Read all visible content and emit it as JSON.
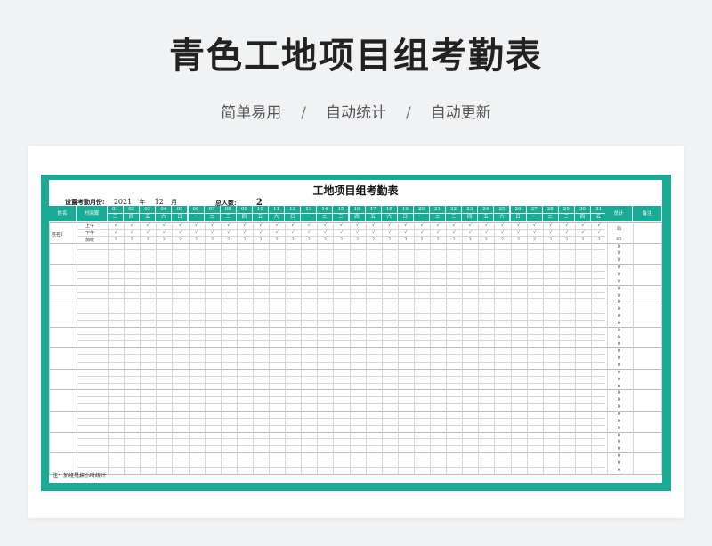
{
  "hero": {
    "title": "青色工地项目组考勤表",
    "subtitles": [
      "简单易用",
      "自动统计",
      "自动更新"
    ],
    "separator": "/"
  },
  "sheet": {
    "title": "工地项目组考勤表",
    "month_label": "设置考勤月份:",
    "year": "2021",
    "year_unit": "年",
    "month": "12",
    "month_unit": "月",
    "people_label": "总人数:",
    "people_count": "2",
    "header": {
      "name": "姓名",
      "time_period": "时间算",
      "total": "总计",
      "remark": "备注"
    },
    "days": [
      "01",
      "02",
      "03",
      "04",
      "05",
      "06",
      "07",
      "08",
      "09",
      "10",
      "11",
      "12",
      "13",
      "14",
      "15",
      "16",
      "17",
      "18",
      "19",
      "20",
      "21",
      "22",
      "23",
      "24",
      "25",
      "26",
      "27",
      "28",
      "29",
      "30",
      "31"
    ],
    "weekdays": [
      "三",
      "四",
      "五",
      "六",
      "日",
      "一",
      "二",
      "三",
      "四",
      "五",
      "六",
      "日",
      "一",
      "二",
      "三",
      "四",
      "五",
      "六",
      "日",
      "一",
      "二",
      "三",
      "四",
      "五",
      "六",
      "日",
      "一",
      "二",
      "三",
      "四",
      "五"
    ],
    "employee": {
      "name": "姓名1",
      "rows": [
        {
          "label": "上午",
          "mark": "√",
          "total": "31"
        },
        {
          "label": "下午",
          "mark": "√",
          "total": ""
        },
        {
          "label": "加班",
          "mark": "2",
          "total": "62"
        }
      ]
    },
    "empty_total": "0",
    "note": "注：加班是按小时统计"
  },
  "colors": {
    "accent": "#1aaa95",
    "page_bg": "#f1f2f4"
  }
}
